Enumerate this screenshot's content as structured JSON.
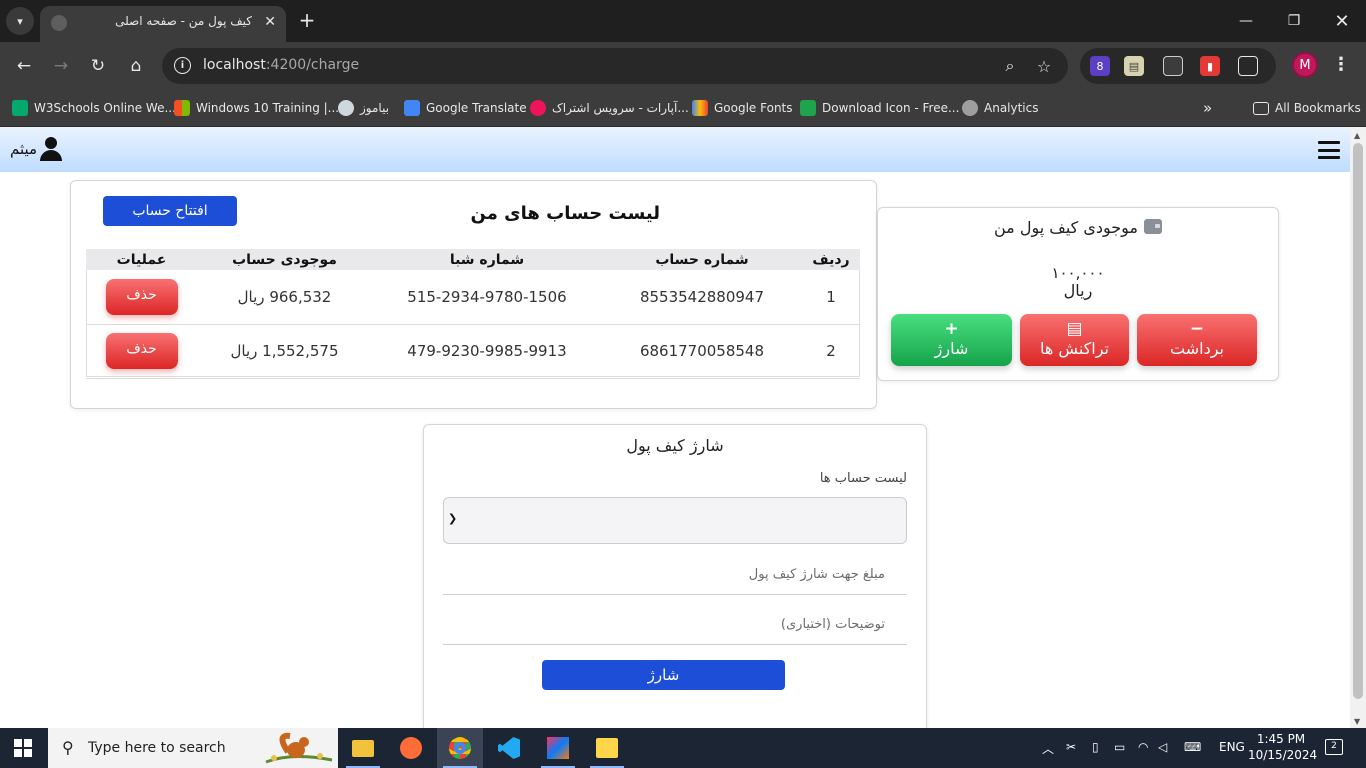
{
  "browser": {
    "tab_title": "کیف پول من - صفحه اصلی",
    "url_host": "localhost",
    "url_path": ":4200/charge",
    "bookmarks": [
      {
        "label": "W3Schools Online We..."
      },
      {
        "label": "Windows 10 Training |..."
      },
      {
        "label": "بیاموز"
      },
      {
        "label": "Google Translate"
      },
      {
        "label": "آپارات - سرویس اشتراک..."
      },
      {
        "label": "Google Fonts"
      },
      {
        "label": "Download Icon - Free..."
      },
      {
        "label": "Analytics"
      }
    ],
    "all_bookmarks_label": "All Bookmarks",
    "profile_initial": "M",
    "extension_badge": "8"
  },
  "header": {
    "user_name": "میثم"
  },
  "accounts": {
    "title": "لیست حساب های من",
    "open_button": "افتتاح حساب",
    "columns": [
      "ردیف",
      "شماره حساب",
      "شماره شبا",
      "موجودی حساب",
      "عملیات"
    ],
    "rows": [
      {
        "index": "1",
        "account": "8553542880947",
        "sheba": "515-2934-9780-1506",
        "balance": "966,532 ریال",
        "action": "حذف"
      },
      {
        "index": "2",
        "account": "6861770058548",
        "sheba": "479-9230-9985-9913",
        "balance": "1,552,575 ریال",
        "action": "حذف"
      }
    ]
  },
  "wallet": {
    "title": "موجودی کیف پول من",
    "amount": "۱۰۰,۰۰۰",
    "currency": "ریال",
    "buttons": {
      "withdraw_glyph": "−",
      "withdraw": "برداشت",
      "transactions_glyph": "▤",
      "transactions": "تراکنش ها",
      "charge_glyph": "+",
      "charge": "شارژ"
    }
  },
  "charge_form": {
    "title": "شارژ کیف پول",
    "account_list_label": "لیست حساب ها",
    "amount_placeholder": "مبلغ جهت شارژ کیف پول",
    "description_placeholder": "توضیحات (اختیاری)",
    "submit": "شارژ"
  },
  "taskbar": {
    "search_placeholder": "Type here to search",
    "language": "ENG",
    "time": "1:45 PM",
    "date": "10/15/2024",
    "notification_count": "2"
  },
  "colors": {
    "primary": "#1d4ed8",
    "danger": "#dc2626",
    "success": "#16a34a",
    "header_gradient_end": "#bfdcff"
  }
}
